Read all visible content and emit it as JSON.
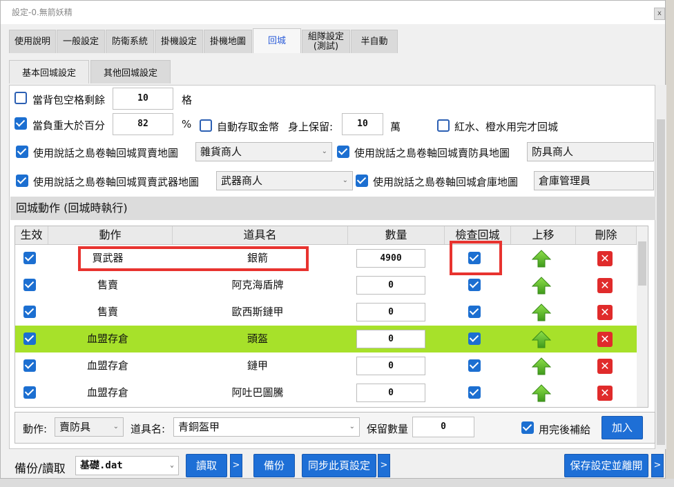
{
  "window": {
    "title": "設定-0.無箭妖精",
    "close_label": "x"
  },
  "main_tabs": [
    "使用說明",
    "一般設定",
    "防衛系統",
    "掛機設定",
    "掛機地圖",
    "回城",
    "組隊設定\n(測試)",
    "半自動"
  ],
  "sub_tabs": [
    "基本回城設定",
    "其他回城設定"
  ],
  "settings": {
    "bag_slots_label": "當背包空格剩餘",
    "bag_slots_value": "10",
    "bag_slots_unit": "格",
    "weight_label": "當負重大於百分",
    "weight_value": "82",
    "weight_unit": "%",
    "auto_deposit_label": "自動存取金幣",
    "keep_label": "身上保留:",
    "keep_value": "10",
    "keep_unit": "萬",
    "potion_label": "紅水、橙水用完才回城",
    "scroll_sell_label": "使用說話之島卷軸回城買賣地圖",
    "scroll_sell_value": "雜貨商人",
    "scroll_armor_label": "使用說話之島卷軸回城賣防具地圖",
    "scroll_armor_value": "防具商人",
    "scroll_weapon_label": "使用說話之島卷軸回城買賣武器地圖",
    "scroll_weapon_value": "武器商人",
    "scroll_warehouse_label": "使用說話之島卷軸回城倉庫地圖",
    "scroll_warehouse_value": "倉庫管理員"
  },
  "section_title": "回城動作 (回城時執行)",
  "grid": {
    "headers": [
      "生效",
      "動作",
      "道具名",
      "數量",
      "檢查回城",
      "上移",
      "刪除"
    ],
    "rows": [
      {
        "action": "買武器",
        "item": "銀箭",
        "qty": "4900"
      },
      {
        "action": "售賣",
        "item": "阿克海盾牌",
        "qty": "0"
      },
      {
        "action": "售賣",
        "item": "歐西斯鏈甲",
        "qty": "0"
      },
      {
        "action": "血盟存倉",
        "item": "頭盔",
        "qty": "0"
      },
      {
        "action": "血盟存倉",
        "item": "鏈甲",
        "qty": "0"
      },
      {
        "action": "血盟存倉",
        "item": "阿吐巴圖騰",
        "qty": "0"
      }
    ]
  },
  "add_form": {
    "action_label": "動作:",
    "action_value": "賣防具",
    "item_label": "道具名:",
    "item_value": "青銅盔甲",
    "keep_label": "保留數量",
    "keep_value": "0",
    "refill_label": "用完後補給",
    "add_label": "加入"
  },
  "footer": {
    "backup_label": "備份/讀取",
    "file_value": "基礎.dat",
    "read_label": "讀取",
    "backup_btn": "備份",
    "sync_label": "同步此頁設定",
    "save_label": "保存設定並離開",
    "more": ">"
  },
  "colors": {
    "accent": "#1e6fd6",
    "highlight_row": "#a7e12a",
    "highlight_box": "#e8332f"
  }
}
